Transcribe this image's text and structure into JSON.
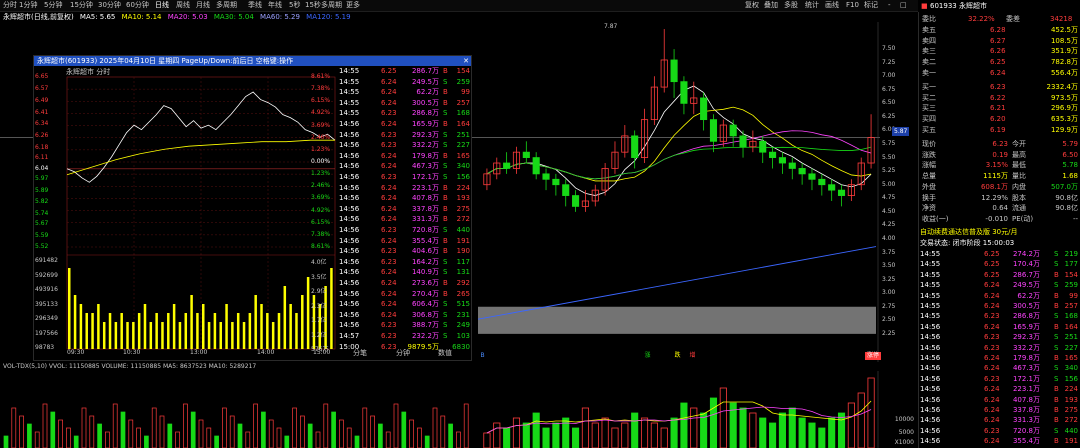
{
  "toolbar": {
    "periods": [
      "分时",
      "1分钟",
      "5分钟",
      "15分钟",
      "30分钟",
      "60分钟",
      "日线",
      "周线",
      "月线",
      "多周期",
      "季线",
      "年线",
      "5秒",
      "15秒",
      "多周期",
      "更多"
    ],
    "right": [
      "复权",
      "叠加",
      "多股",
      "统计",
      "画线",
      "F10",
      "标记",
      "-",
      "□"
    ]
  },
  "info": {
    "stock": "永辉超市(日线,前复权)",
    "ma5": "MA5: 5.65",
    "ma10": "MA10: 5.14",
    "ma20": "MA20: 5.03",
    "ma30": "MA30: 5.04",
    "ma60": "MA60: 5.29",
    "extra": "MA120: 5.19"
  },
  "kline": {
    "price_labels": [
      "7.50",
      "7.25",
      "7.00",
      "6.75",
      "6.50",
      "6.25",
      "6.00",
      "5.75",
      "5.50",
      "5.25",
      "5.00",
      "4.75",
      "4.50",
      "4.25",
      "4.00",
      "3.75",
      "3.50",
      "3.25",
      "3.00",
      "2.75",
      "2.50",
      "2.25"
    ],
    "peak_label": "7.87",
    "current_price": "5.87",
    "signals": [
      "B",
      "涨",
      "跌",
      "增",
      "涨停"
    ],
    "candles": [
      [
        5.0,
        5.2,
        5.3,
        4.9
      ],
      [
        5.2,
        5.4,
        5.5,
        5.1
      ],
      [
        5.4,
        5.3,
        5.6,
        5.2
      ],
      [
        5.3,
        5.6,
        5.7,
        5.2
      ],
      [
        5.6,
        5.5,
        5.8,
        5.4
      ],
      [
        5.5,
        5.2,
        5.6,
        5.1
      ],
      [
        5.2,
        5.1,
        5.3,
        4.9
      ],
      [
        5.1,
        5.0,
        5.2,
        4.8
      ],
      [
        5.0,
        4.8,
        5.1,
        4.6
      ],
      [
        4.8,
        4.6,
        4.9,
        4.5
      ],
      [
        4.6,
        4.7,
        4.9,
        4.5
      ],
      [
        4.7,
        4.9,
        5.0,
        4.6
      ],
      [
        4.9,
        5.3,
        5.4,
        4.8
      ],
      [
        5.3,
        5.6,
        5.8,
        5.2
      ],
      [
        5.6,
        5.9,
        6.1,
        5.5
      ],
      [
        5.9,
        5.5,
        6.0,
        5.3
      ],
      [
        5.5,
        6.2,
        6.4,
        5.4
      ],
      [
        6.2,
        6.8,
        7.0,
        6.1
      ],
      [
        6.8,
        7.3,
        7.87,
        6.7
      ],
      [
        7.3,
        6.9,
        7.5,
        6.6
      ],
      [
        6.9,
        6.5,
        7.0,
        6.3
      ],
      [
        6.5,
        6.6,
        6.9,
        6.3
      ],
      [
        6.6,
        6.2,
        6.7,
        6.0
      ],
      [
        6.2,
        5.8,
        6.3,
        5.6
      ],
      [
        5.8,
        6.1,
        6.2,
        5.7
      ],
      [
        6.1,
        5.9,
        6.2,
        5.7
      ],
      [
        5.9,
        5.7,
        6.0,
        5.5
      ],
      [
        5.7,
        5.8,
        6.0,
        5.6
      ],
      [
        5.8,
        5.6,
        5.9,
        5.4
      ],
      [
        5.6,
        5.5,
        5.7,
        5.3
      ],
      [
        5.5,
        5.4,
        5.6,
        5.2
      ],
      [
        5.4,
        5.3,
        5.5,
        5.1
      ],
      [
        5.3,
        5.2,
        5.4,
        5.0
      ],
      [
        5.2,
        5.1,
        5.3,
        4.9
      ],
      [
        5.1,
        5.0,
        5.2,
        4.8
      ],
      [
        5.0,
        4.9,
        5.1,
        4.7
      ],
      [
        4.9,
        4.8,
        5.0,
        4.6
      ],
      [
        4.8,
        5.0,
        5.1,
        4.7
      ],
      [
        5.0,
        5.4,
        5.5,
        4.9
      ],
      [
        5.4,
        5.87,
        6.3,
        5.3
      ]
    ]
  },
  "popup": {
    "title": "永辉超市(601933) 2025年04月10日 星期四 PageUp/Down:前后日 空格键:操作",
    "subtitle": "永辉超市  分时",
    "left_prices": [
      "6.65",
      "6.57",
      "6.49",
      "6.41",
      "6.34",
      "6.26",
      "6.18",
      "6.11",
      "6.04",
      "5.97",
      "5.89",
      "5.82",
      "5.74",
      "5.67",
      "5.59",
      "5.52"
    ],
    "right_pcts": [
      "8.61%",
      "7.38%",
      "6.15%",
      "4.92%",
      "3.69%",
      "2.46%",
      "1.23%",
      "0.00%",
      "1.23%",
      "2.46%",
      "3.69%",
      "4.92%",
      "6.15%",
      "7.38%",
      "8.61%"
    ],
    "vol_left": [
      "691482",
      "592699",
      "493916",
      "395133",
      "296349",
      "197566",
      "98783"
    ],
    "vol_right": [
      "4.0亿",
      "3.5亿",
      "2.9亿",
      "2.3亿",
      "1.7亿",
      "1.2亿",
      "576万"
    ],
    "times": [
      "09:30",
      "10:30",
      "13:00",
      "14:00",
      "15:00"
    ],
    "buttons": [
      "分笔",
      "分钟",
      "数值"
    ],
    "intraday": [
      6.04,
      6.02,
      5.98,
      5.95,
      5.99,
      6.05,
      6.12,
      6.2,
      6.28,
      6.33,
      6.3,
      6.35,
      6.4,
      6.46,
      6.44,
      6.38,
      6.32,
      6.36,
      6.31,
      6.33,
      6.3,
      6.35,
      6.4,
      6.46,
      6.52,
      6.55,
      6.5,
      6.48,
      6.45,
      6.4,
      6.38,
      6.35,
      6.3,
      6.28,
      6.25,
      6.27,
      6.23
    ],
    "avg": [
      6.0,
      6.05,
      6.1,
      6.14,
      6.17,
      6.19,
      6.2,
      6.21,
      6.22,
      6.22,
      6.23,
      6.23
    ],
    "vol_bars": [
      9,
      6,
      5,
      4,
      4,
      5,
      3,
      4,
      3,
      4,
      3,
      3,
      4,
      5,
      3,
      4,
      3,
      4,
      5,
      3,
      4,
      6,
      4,
      5,
      3,
      4,
      3,
      5,
      3,
      4,
      3,
      4,
      6,
      5,
      4,
      3,
      4,
      7,
      5,
      4,
      6,
      8,
      6,
      5,
      7,
      9
    ]
  },
  "popup_ticks": [
    [
      "14:55",
      "6.25",
      "286.7万",
      "B",
      "154"
    ],
    [
      "14:55",
      "6.24",
      "249.5万",
      "S",
      "259"
    ],
    [
      "14:55",
      "6.24",
      "62.2万",
      "B",
      "99"
    ],
    [
      "14:55",
      "6.24",
      "300.5万",
      "B",
      "257"
    ],
    [
      "14:55",
      "6.23",
      "286.8万",
      "S",
      "168"
    ],
    [
      "14:56",
      "6.24",
      "165.9万",
      "B",
      "164"
    ],
    [
      "14:56",
      "6.23",
      "292.3万",
      "S",
      "251"
    ],
    [
      "14:56",
      "6.23",
      "332.2万",
      "S",
      "227"
    ],
    [
      "14:56",
      "6.24",
      "179.8万",
      "B",
      "165"
    ],
    [
      "14:56",
      "6.24",
      "467.3万",
      "S",
      "340"
    ],
    [
      "14:56",
      "6.23",
      "172.1万",
      "S",
      "156"
    ],
    [
      "14:56",
      "6.24",
      "223.1万",
      "B",
      "224"
    ],
    [
      "14:56",
      "6.24",
      "407.8万",
      "B",
      "193"
    ],
    [
      "14:56",
      "6.24",
      "337.8万",
      "B",
      "275"
    ],
    [
      "14:56",
      "6.24",
      "331.3万",
      "B",
      "272"
    ],
    [
      "14:56",
      "6.23",
      "720.8万",
      "S",
      "440"
    ],
    [
      "14:56",
      "6.24",
      "355.4万",
      "B",
      "191"
    ],
    [
      "14:56",
      "6.23",
      "404.6万",
      "B",
      "190"
    ],
    [
      "14:56",
      "6.23",
      "164.2万",
      "S",
      "117"
    ],
    [
      "14:56",
      "6.24",
      "140.9万",
      "S",
      "131"
    ],
    [
      "14:56",
      "6.24",
      "273.6万",
      "B",
      "292"
    ],
    [
      "14:56",
      "6.24",
      "270.4万",
      "B",
      "265"
    ],
    [
      "14:56",
      "6.24",
      "606.4万",
      "S",
      "515"
    ],
    [
      "14:56",
      "6.24",
      "306.8万",
      "S",
      "231"
    ],
    [
      "14:56",
      "6.23",
      "388.7万",
      "S",
      "249"
    ],
    [
      "14:57",
      "6.23",
      "232.2万",
      "S",
      "103"
    ],
    [
      "15:00",
      "6.23",
      "9879.5万",
      "",
      "6830"
    ]
  ],
  "quote": {
    "header": "601933 永辉超市",
    "weibi_label": "委比",
    "weibi_val": "32.22%",
    "weicha_label": "委差",
    "weicha_val": "34218",
    "asks": [
      [
        "卖五",
        "6.28",
        "452.5万"
      ],
      [
        "卖四",
        "6.27",
        "108.5万"
      ],
      [
        "卖三",
        "6.26",
        "351.9万"
      ],
      [
        "卖二",
        "6.25",
        "782.8万"
      ],
      [
        "卖一",
        "6.24",
        "556.4万"
      ]
    ],
    "bids": [
      [
        "买一",
        "6.23",
        "2332.4万"
      ],
      [
        "买二",
        "6.22",
        "973.5万"
      ],
      [
        "买三",
        "6.21",
        "296.9万"
      ],
      [
        "买四",
        "6.20",
        "635.3万"
      ],
      [
        "买五",
        "6.19",
        "129.9万"
      ]
    ],
    "stats": [
      [
        "现价",
        "6.23",
        "今开",
        "5.79"
      ],
      [
        "涨跌",
        "0.19",
        "最高",
        "6.50"
      ],
      [
        "涨幅",
        "3.15%",
        "最低",
        "5.78"
      ],
      [
        "总量",
        "1115万",
        "量比",
        "1.68"
      ],
      [
        "外盘",
        "608.1万",
        "内盘",
        "507.0万"
      ],
      [
        "换手",
        "12.29%",
        "股本",
        "90.8亿"
      ],
      [
        "净资",
        "0.64",
        "流通",
        "90.8亿"
      ],
      [
        "收益(一)",
        "-0.010",
        "PE(动)",
        "--"
      ]
    ],
    "banner": "自动续费通达信普及版  30元/月",
    "state": "交易状态: 闭市阶段 15:00:03"
  },
  "right_ticks": [
    [
      "14:55",
      "6.25",
      "274.2万",
      "S",
      "219"
    ],
    [
      "14:55",
      "6.25",
      "170.4万",
      "S",
      "177"
    ],
    [
      "14:55",
      "6.25",
      "286.7万",
      "B",
      "154"
    ],
    [
      "14:55",
      "6.24",
      "249.5万",
      "S",
      "259"
    ],
    [
      "14:55",
      "6.24",
      "62.2万",
      "B",
      "99"
    ],
    [
      "14:55",
      "6.24",
      "300.5万",
      "B",
      "257"
    ],
    [
      "14:55",
      "6.23",
      "286.8万",
      "S",
      "168"
    ],
    [
      "14:56",
      "6.24",
      "165.9万",
      "B",
      "164"
    ],
    [
      "14:56",
      "6.23",
      "292.3万",
      "S",
      "251"
    ],
    [
      "14:56",
      "6.23",
      "332.2万",
      "S",
      "227"
    ],
    [
      "14:56",
      "6.24",
      "179.8万",
      "B",
      "165"
    ],
    [
      "14:56",
      "6.24",
      "467.3万",
      "S",
      "340"
    ],
    [
      "14:56",
      "6.23",
      "172.1万",
      "S",
      "156"
    ],
    [
      "14:56",
      "6.24",
      "223.1万",
      "B",
      "224"
    ],
    [
      "14:56",
      "6.24",
      "407.8万",
      "B",
      "193"
    ],
    [
      "14:56",
      "6.24",
      "337.8万",
      "B",
      "275"
    ],
    [
      "14:56",
      "6.24",
      "331.3万",
      "B",
      "272"
    ],
    [
      "14:56",
      "6.23",
      "720.8万",
      "S",
      "440"
    ],
    [
      "14:56",
      "6.24",
      "355.4万",
      "B",
      "191"
    ]
  ],
  "volume": {
    "header": "VOL-TDX(5,10)  VVOL: 11150885  VOLUME: 11150885  MA5: 8637523  MA10: 5289217",
    "axis": [
      "10000",
      "5000",
      "X1000"
    ],
    "bars": [
      3,
      5,
      4,
      6,
      5,
      7,
      4,
      5,
      6,
      4,
      8,
      5,
      6,
      4,
      5,
      7,
      6,
      5,
      4,
      6,
      9,
      8,
      7,
      10,
      12,
      9,
      8,
      7,
      6,
      5,
      7,
      8,
      6,
      5,
      4,
      6,
      7,
      9,
      11,
      14
    ]
  },
  "colors": {
    "up": "#ff3c3c",
    "down": "#17d917",
    "accent": "#ffff00",
    "popup_title": "#2050c0"
  }
}
